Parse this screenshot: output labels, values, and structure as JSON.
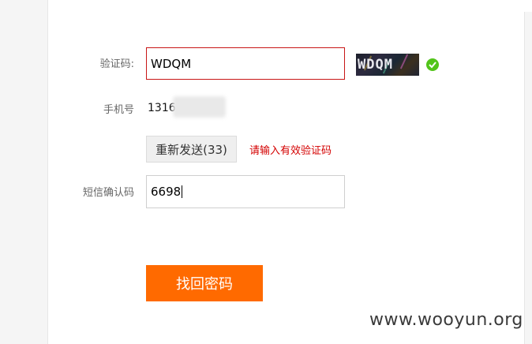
{
  "form": {
    "captcha": {
      "label": "验证码:",
      "value": "WDQM",
      "image_text": "WDQM",
      "status_icon": "check-circle-icon",
      "status_color": "#52c41a"
    },
    "phone": {
      "label": "手机号",
      "visible_value": "1316"
    },
    "resend": {
      "button_label": "重新发送(33)",
      "error_message": "请输入有效验证码",
      "error_color": "#d40000"
    },
    "sms_code": {
      "label": "短信确认码",
      "value": "6698"
    },
    "submit_label": "找回密码"
  },
  "colors": {
    "accent": "#ff6a00",
    "error_border": "#c81616"
  },
  "watermark": "www.wooyun.org"
}
